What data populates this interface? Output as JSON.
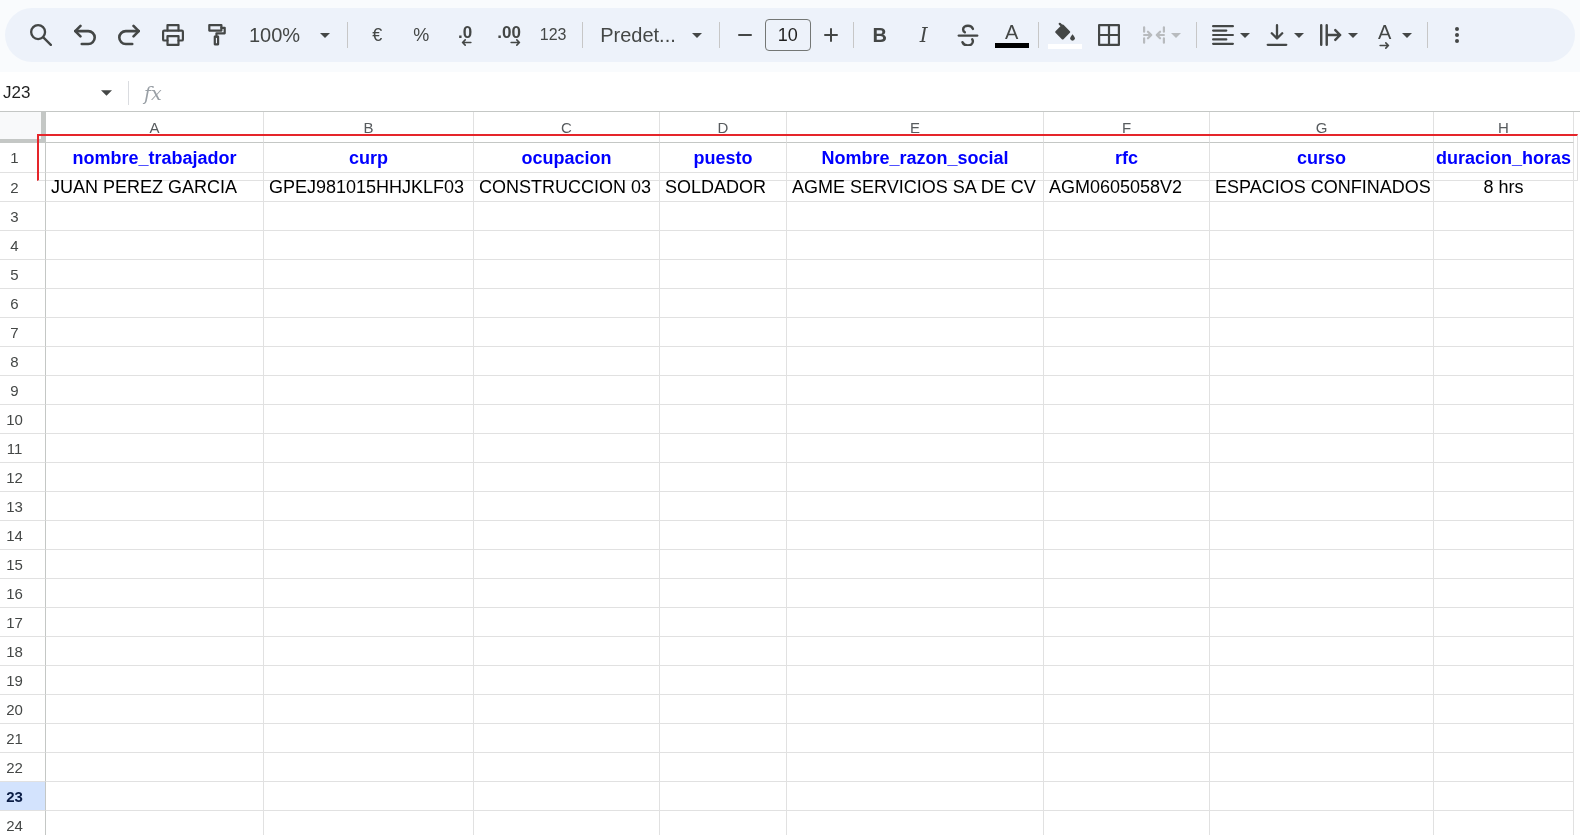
{
  "toolbar": {
    "zoom": "100%",
    "currency": "€",
    "percent": "%",
    "decrease_decimals": ".0",
    "increase_decimals": ".00",
    "number_format": "123",
    "font": "Predet...",
    "font_size": "10",
    "bold": "B",
    "italic": "I",
    "text_color": "A",
    "merge_cells": {
      "disabled": true
    },
    "text_rotation": "A"
  },
  "formula_bar": {
    "cell_reference": "J23",
    "function_label": "fx"
  },
  "sheet": {
    "columns": [
      "A",
      "B",
      "C",
      "D",
      "E",
      "F",
      "G",
      "H"
    ],
    "rows": [
      {
        "number": "1",
        "selected": false,
        "outlined": true,
        "kind": "header",
        "cells": [
          {
            "text": "nombre_trabajador",
            "centered": true
          },
          {
            "text": "curp",
            "centered": true
          },
          {
            "text": "ocupacion",
            "centered": true
          },
          {
            "text": "puesto",
            "centered": true
          },
          {
            "text": "Nombre_razon_social",
            "centered": true
          },
          {
            "text": "rfc",
            "centered": true
          },
          {
            "text": "curso",
            "centered": true
          },
          {
            "text": "duracion_horas",
            "centered": true
          }
        ]
      },
      {
        "number": "2",
        "selected": false,
        "outlined": false,
        "kind": "data",
        "cells": [
          {
            "text": "JUAN PEREZ GARCIA",
            "centered": false
          },
          {
            "text": "GPEJ981015HHJKLF03",
            "centered": false
          },
          {
            "text": "CONSTRUCCION 03",
            "centered": false
          },
          {
            "text": "SOLDADOR",
            "centered": false
          },
          {
            "text": "AGME SERVICIOS SA DE CV",
            "centered": false
          },
          {
            "text": "AGM0605058V2",
            "centered": false
          },
          {
            "text": "ESPACIOS CONFINADOS",
            "centered": false
          },
          {
            "text": "8 hrs",
            "centered": true
          }
        ]
      },
      {
        "number": "3",
        "selected": false,
        "outlined": false
      },
      {
        "number": "4",
        "selected": false,
        "outlined": false
      },
      {
        "number": "5",
        "selected": false,
        "outlined": false
      },
      {
        "number": "6",
        "selected": false,
        "outlined": false
      },
      {
        "number": "7",
        "selected": false,
        "outlined": false
      },
      {
        "number": "8",
        "selected": false,
        "outlined": false
      },
      {
        "number": "9",
        "selected": false,
        "outlined": false
      },
      {
        "number": "10",
        "selected": false,
        "outlined": false
      },
      {
        "number": "11",
        "selected": false,
        "outlined": false
      },
      {
        "number": "12",
        "selected": false,
        "outlined": false
      },
      {
        "number": "13",
        "selected": false,
        "outlined": false
      },
      {
        "number": "14",
        "selected": false,
        "outlined": false
      },
      {
        "number": "15",
        "selected": false,
        "outlined": false
      },
      {
        "number": "16",
        "selected": false,
        "outlined": false
      },
      {
        "number": "17",
        "selected": false,
        "outlined": false
      },
      {
        "number": "18",
        "selected": false,
        "outlined": false
      },
      {
        "number": "19",
        "selected": false,
        "outlined": false
      },
      {
        "number": "20",
        "selected": false,
        "outlined": false
      },
      {
        "number": "21",
        "selected": false,
        "outlined": false
      },
      {
        "number": "22",
        "selected": false,
        "outlined": false
      },
      {
        "number": "23",
        "selected": true,
        "outlined": false
      },
      {
        "number": "24",
        "selected": false,
        "outlined": false
      }
    ]
  }
}
